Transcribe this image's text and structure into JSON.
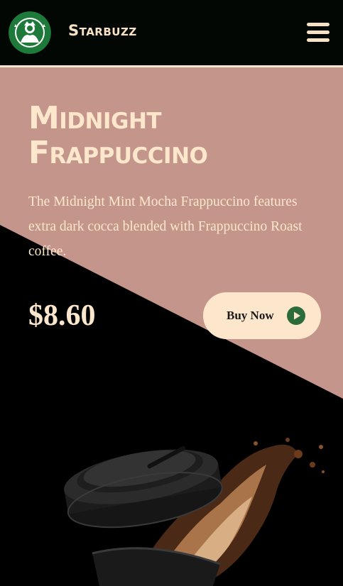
{
  "header": {
    "brand": "Starbuzz",
    "logo_icon": "siren-logo-icon",
    "menu_icon": "hamburger-menu-icon"
  },
  "hero": {
    "title_line1": "Midnight",
    "title_line2": "Frappuccino",
    "description": "The Midnight Mint Mocha Frappuccino features extra dark cocca blended with Frappuccino Roast coffee.",
    "price": "$8.60",
    "buy_button_label": "Buy Now",
    "buy_button_icon": "play-circle-icon"
  },
  "colors": {
    "background": "#000000",
    "header_bg": "#030703",
    "accent_pink": "#c4958a",
    "cream": "#fde7cc",
    "brand_green": "#2c6b3a"
  }
}
